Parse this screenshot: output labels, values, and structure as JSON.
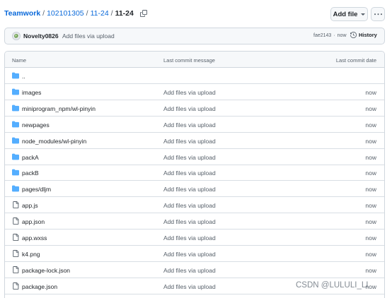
{
  "breadcrumb": {
    "items": [
      "Teamwork",
      "102101305",
      "11-24"
    ],
    "current": "11-24",
    "separator": "/"
  },
  "toolbar": {
    "add_file_label": "Add file",
    "more_icon": "kebab-horizontal-icon"
  },
  "commit": {
    "author": "Novelty0826",
    "message": "Add files via upload",
    "sha": "fae2143",
    "dot": "·",
    "time": "now",
    "history_label": "History"
  },
  "table": {
    "headers": {
      "name": "Name",
      "message": "Last commit message",
      "date": "Last commit date"
    },
    "rows": [
      {
        "name": "..",
        "type": "folder",
        "message": "",
        "date": ""
      },
      {
        "name": "images",
        "type": "folder",
        "message": "Add files via upload",
        "date": "now"
      },
      {
        "name": "miniprogram_npm/wl-pinyin",
        "type": "folder",
        "message": "Add files via upload",
        "date": "now"
      },
      {
        "name": "newpages",
        "type": "folder",
        "message": "Add files via upload",
        "date": "now"
      },
      {
        "name": "node_modules/wl-pinyin",
        "type": "folder",
        "message": "Add files via upload",
        "date": "now"
      },
      {
        "name": "packA",
        "type": "folder",
        "message": "Add files via upload",
        "date": "now"
      },
      {
        "name": "packB",
        "type": "folder",
        "message": "Add files via upload",
        "date": "now"
      },
      {
        "name": "pages/dljm",
        "type": "folder",
        "message": "Add files via upload",
        "date": "now"
      },
      {
        "name": "app.js",
        "type": "file",
        "message": "Add files via upload",
        "date": "now"
      },
      {
        "name": "app.json",
        "type": "file",
        "message": "Add files via upload",
        "date": "now"
      },
      {
        "name": "app.wxss",
        "type": "file",
        "message": "Add files via upload",
        "date": "now"
      },
      {
        "name": "k4.png",
        "type": "file",
        "message": "Add files via upload",
        "date": "now"
      },
      {
        "name": "package-lock.json",
        "type": "file",
        "message": "Add files via upload",
        "date": "now"
      },
      {
        "name": "package.json",
        "type": "file",
        "message": "Add files via upload",
        "date": "now"
      }
    ]
  },
  "watermark": "CSDN @LULULI_LI",
  "colors": {
    "link": "#0969da",
    "folder": "#54aeff",
    "border": "#d0d7de",
    "muted": "#57606a"
  }
}
